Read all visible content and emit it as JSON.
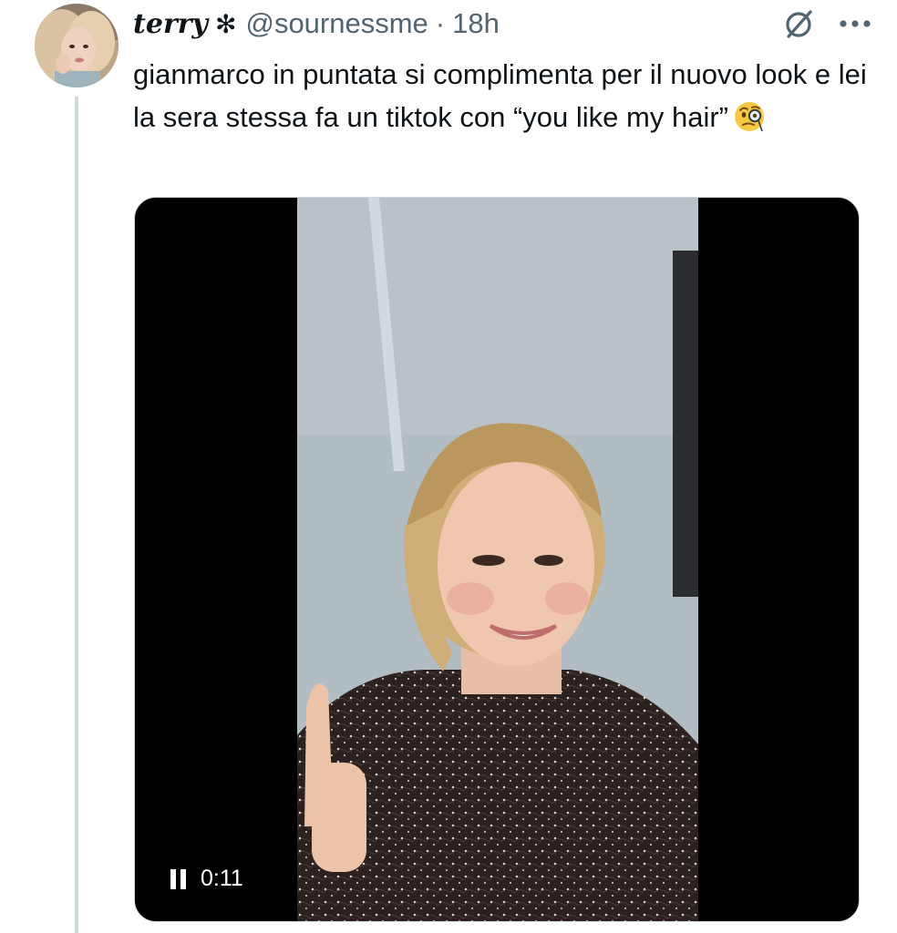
{
  "tweet": {
    "display_name": "terry",
    "name_glyph": "✻",
    "handle": "@sournessme",
    "separator": "·",
    "time": "18h",
    "text": "gianmarco in puntata si complimenta per il nuovo look e lei la sera stessa fa un tiktok con “you like my hair”",
    "emoji_icon": "face-with-monocle-icon"
  },
  "header_actions": {
    "grok_icon": "grok-icon",
    "more_icon": "more-options-icon"
  },
  "video": {
    "elapsed": "0:11",
    "state_icon": "pause-icon"
  },
  "colors": {
    "text_primary": "#0f1419",
    "text_secondary": "#536471",
    "border": "#cfd9de",
    "media_background": "#000000"
  }
}
